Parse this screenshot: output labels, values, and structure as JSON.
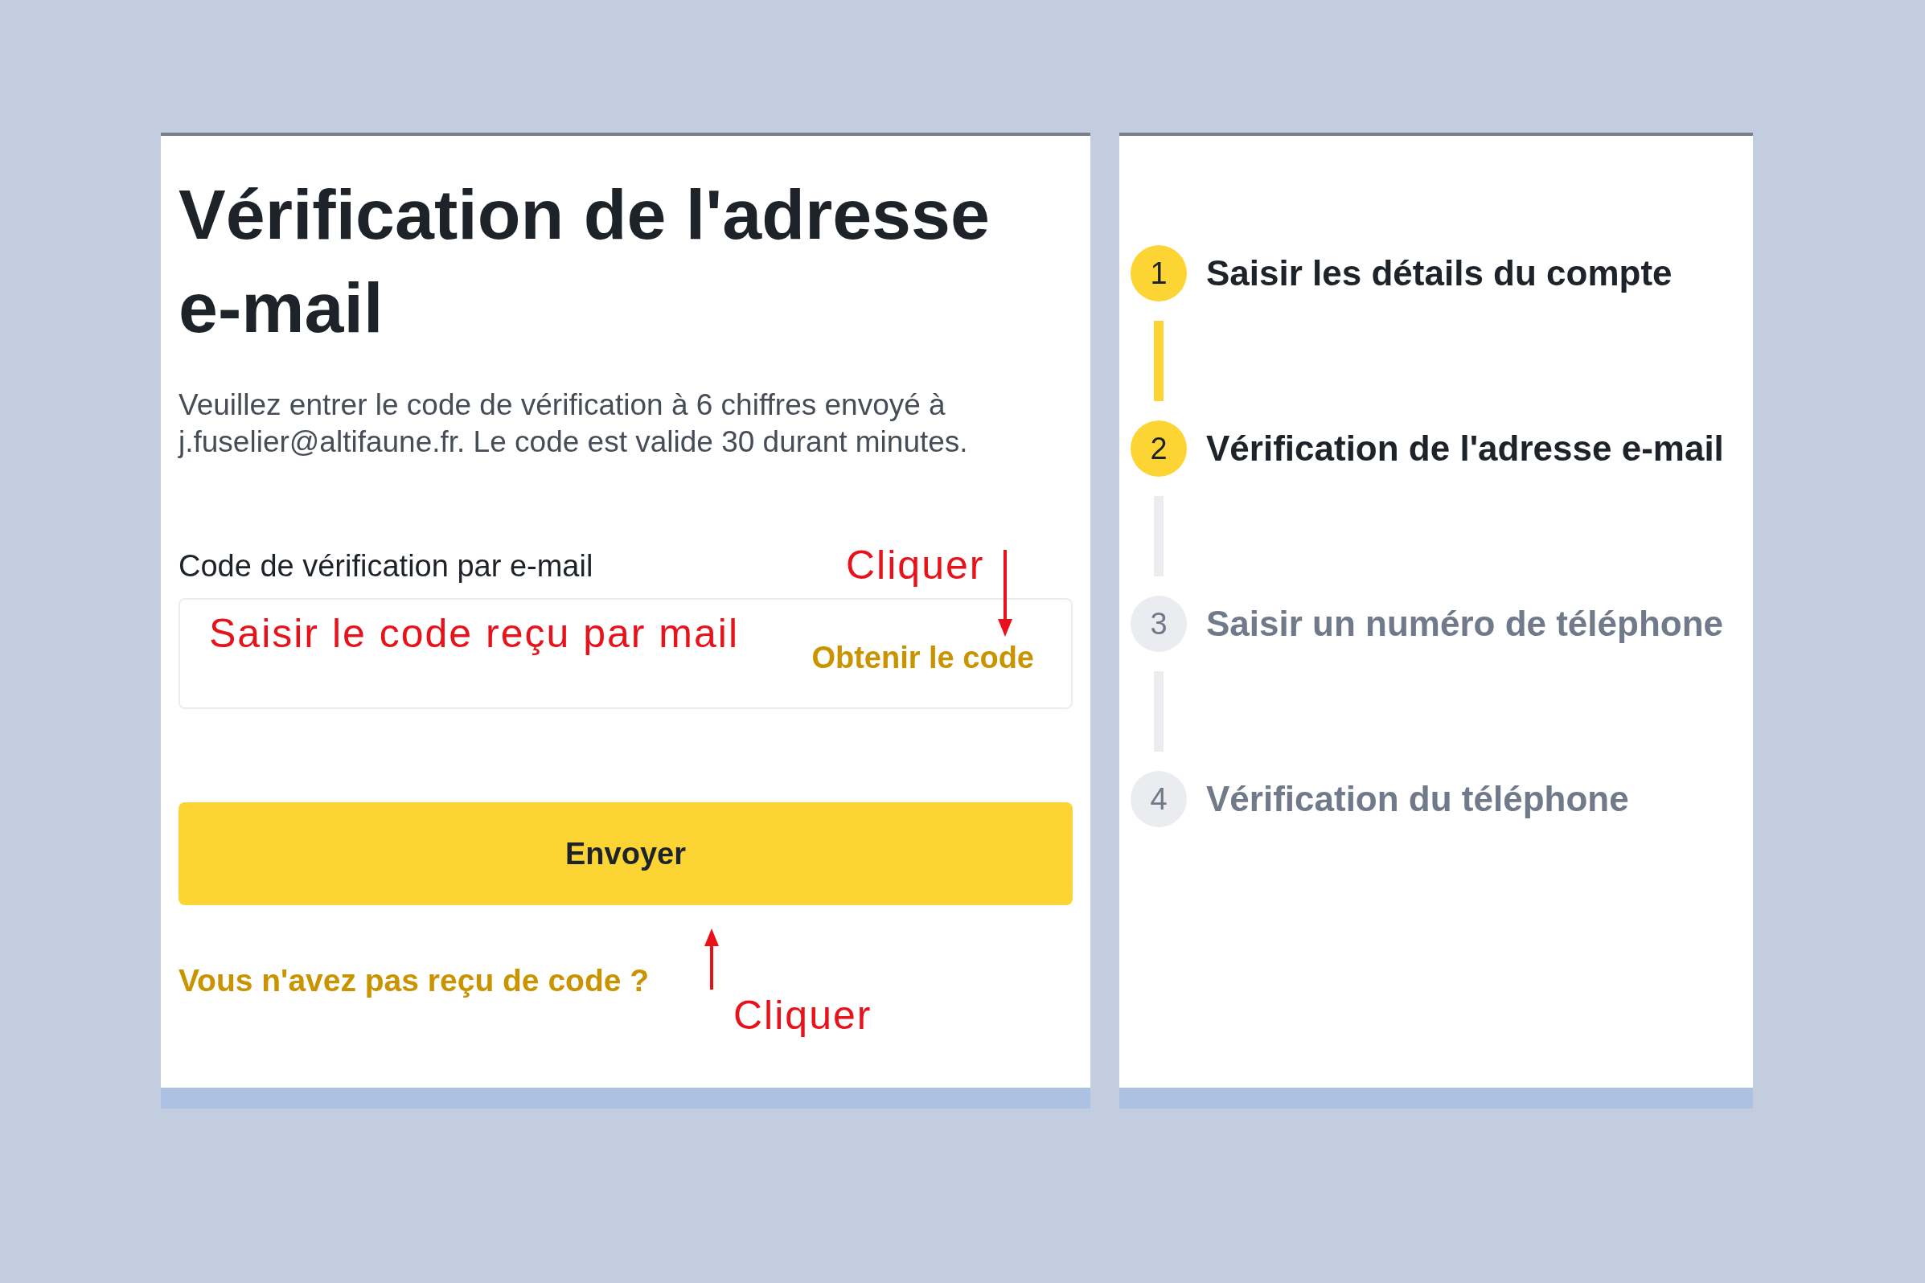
{
  "form": {
    "title": "Vérification de l'adresse e-mail",
    "description": "Veuillez entrer le code de vérification à 6 chiffres envoyé à j.fuselier@altifaune.fr. Le code est valide 30 durant minutes.",
    "field_label": "Code de vérification par e-mail",
    "get_code_link": "Obtenir le code",
    "submit_button": "Envoyer",
    "no_code_link": "Vous n'avez pas reçu de code ?"
  },
  "annotations": {
    "field_hint": "Saisir le code reçu par mail",
    "click_top": "Cliquer",
    "click_bottom": "Cliquer"
  },
  "steps": [
    {
      "number": "1",
      "label": "Saisir les détails du compte",
      "completed": true,
      "active": false
    },
    {
      "number": "2",
      "label": "Vérification de l'adresse e-mail",
      "completed": false,
      "active": true
    },
    {
      "number": "3",
      "label": "Saisir un numéro de téléphone",
      "completed": false,
      "active": false
    },
    {
      "number": "4",
      "label": "Vérification du téléphone",
      "completed": false,
      "active": false
    }
  ]
}
